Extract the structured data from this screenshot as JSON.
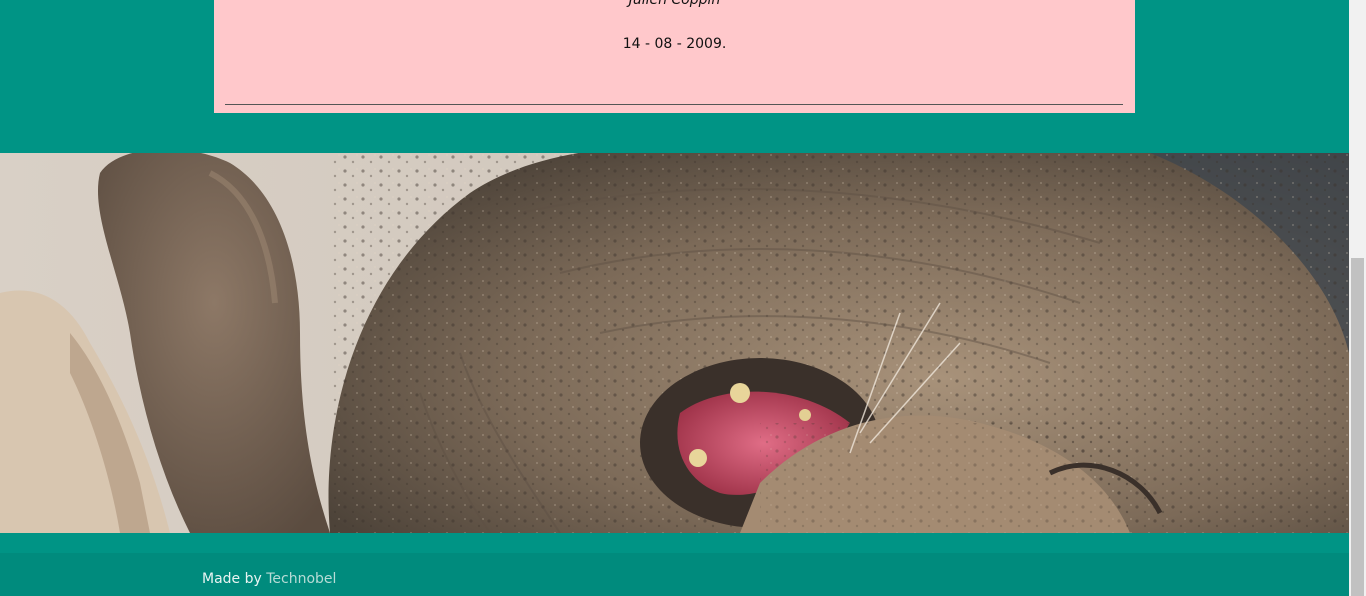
{
  "card": {
    "author": "Julien Coppin",
    "date": "14 - 08 - 2009."
  },
  "banner": {
    "icon": "seal-photo"
  },
  "footer": {
    "made_by": "Made by ",
    "link_label": "Technobel"
  },
  "colors": {
    "page_background": "#009485",
    "card_background": "#ffc8cb",
    "footer_background": "#008b7d",
    "footer_link": "#b7dcd6"
  }
}
